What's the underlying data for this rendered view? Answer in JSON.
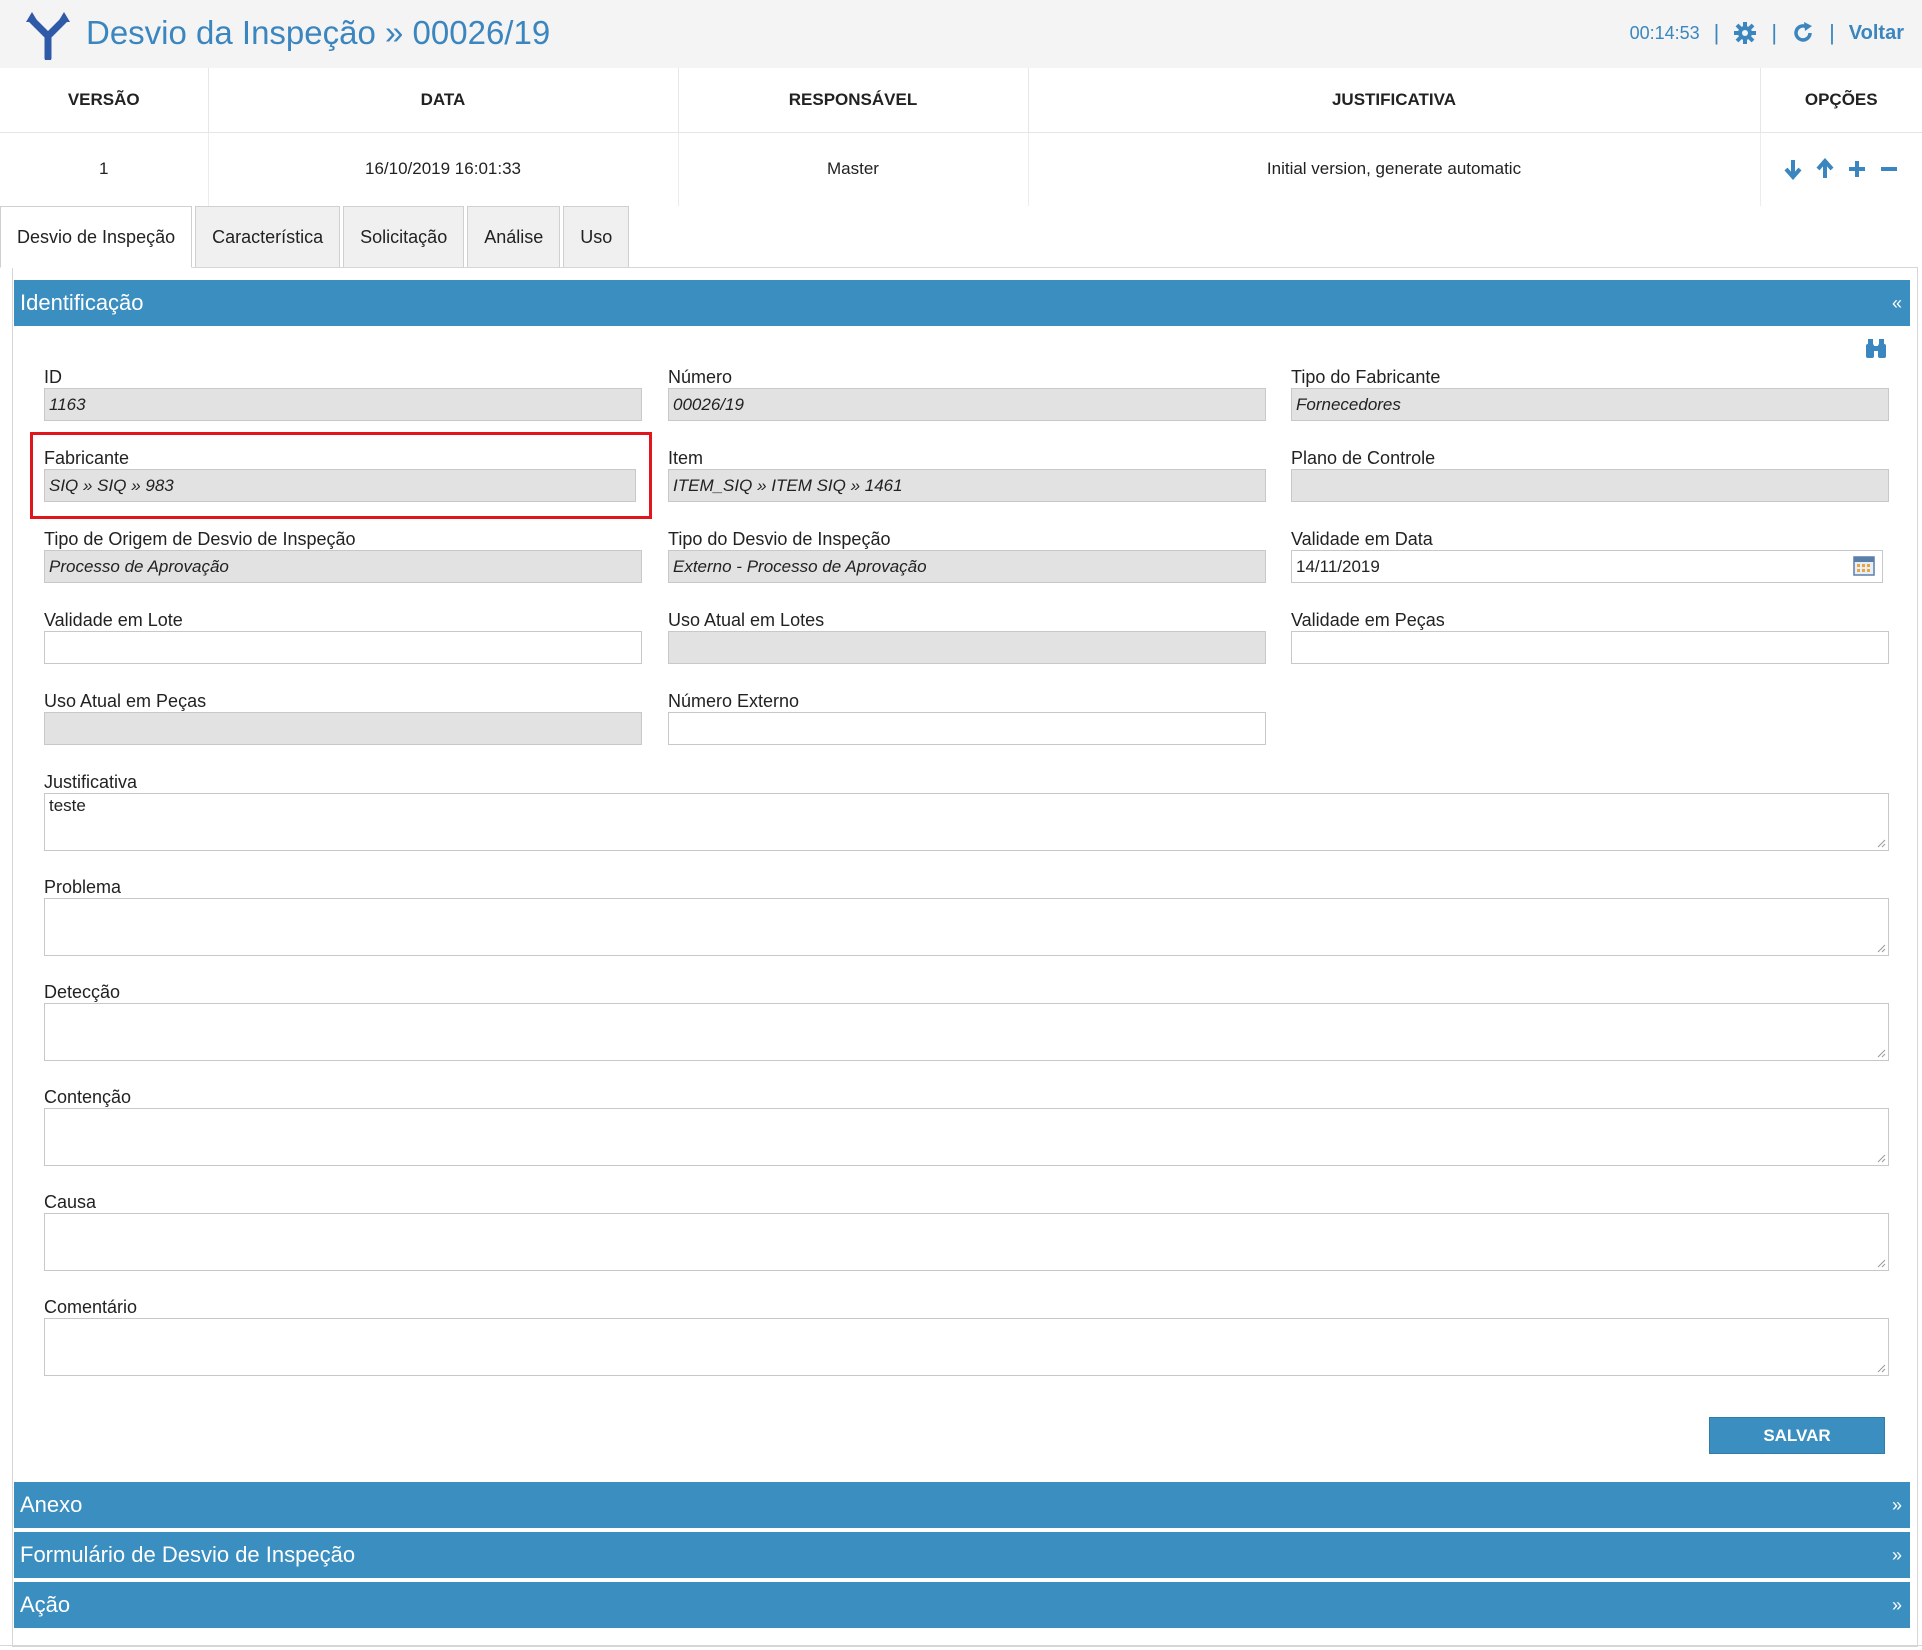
{
  "header": {
    "title": "Desvio da Inspeção » 00026/19",
    "timer": "00:14:53",
    "back_label": "Voltar",
    "icons": [
      "settings-icon",
      "refresh-icon"
    ]
  },
  "version_table": {
    "columns": [
      "VERSÃO",
      "DATA",
      "RESPONSÁVEL",
      "JUSTIFICATIVA",
      "OPÇÕES"
    ],
    "row": {
      "versao": "1",
      "data": "16/10/2019 16:01:33",
      "responsavel": "Master",
      "justificativa": "Initial version, generate automatic"
    },
    "option_icons": [
      "arrow-down-icon",
      "arrow-up-icon",
      "plus-icon",
      "minus-icon"
    ]
  },
  "tabs": [
    {
      "label": "Desvio de Inspeção",
      "active": true
    },
    {
      "label": "Característica"
    },
    {
      "label": "Solicitação"
    },
    {
      "label": "Análise"
    },
    {
      "label": "Uso"
    }
  ],
  "sections": {
    "identificacao": "Identificação",
    "anexo": "Anexo",
    "formulario": "Formulário de Desvio de Inspeção",
    "acao": "Ação",
    "collapse_glyph": "«",
    "expand_glyph": "»"
  },
  "form": {
    "id": {
      "label": "ID",
      "value": "1163"
    },
    "numero": {
      "label": "Número",
      "value": "00026/19"
    },
    "tipo_fabricante": {
      "label": "Tipo do Fabricante",
      "value": "Fornecedores"
    },
    "fabricante": {
      "label": "Fabricante",
      "value": "SIQ » SIQ » 983"
    },
    "item": {
      "label": "Item",
      "value": "ITEM_SIQ » ITEM SIQ » 1461"
    },
    "plano_controle": {
      "label": "Plano de Controle",
      "value": ""
    },
    "tipo_origem": {
      "label": "Tipo de Origem de Desvio de Inspeção",
      "value": "Processo de Aprovação"
    },
    "tipo_desvio": {
      "label": "Tipo do Desvio de Inspeção",
      "value": "Externo - Processo de Aprovação"
    },
    "validade_data": {
      "label": "Validade em Data",
      "value": "14/11/2019"
    },
    "validade_lote": {
      "label": "Validade em Lote",
      "value": ""
    },
    "uso_atual_lotes": {
      "label": "Uso Atual em Lotes",
      "value": ""
    },
    "validade_pecas": {
      "label": "Validade em Peças",
      "value": ""
    },
    "uso_atual_pecas": {
      "label": "Uso Atual em Peças",
      "value": ""
    },
    "numero_externo": {
      "label": "Número Externo",
      "value": ""
    },
    "justificativa": {
      "label": "Justificativa",
      "value": "teste"
    },
    "problema": {
      "label": "Problema",
      "value": ""
    },
    "deteccao": {
      "label": "Detecção",
      "value": ""
    },
    "contencao": {
      "label": "Contenção",
      "value": ""
    },
    "causa": {
      "label": "Causa",
      "value": ""
    },
    "comentario": {
      "label": "Comentário",
      "value": ""
    }
  },
  "save_label": "SALVAR",
  "colors": {
    "accent": "#3b8ec0",
    "title": "#3b86bf",
    "highlight": "#e0161c"
  }
}
